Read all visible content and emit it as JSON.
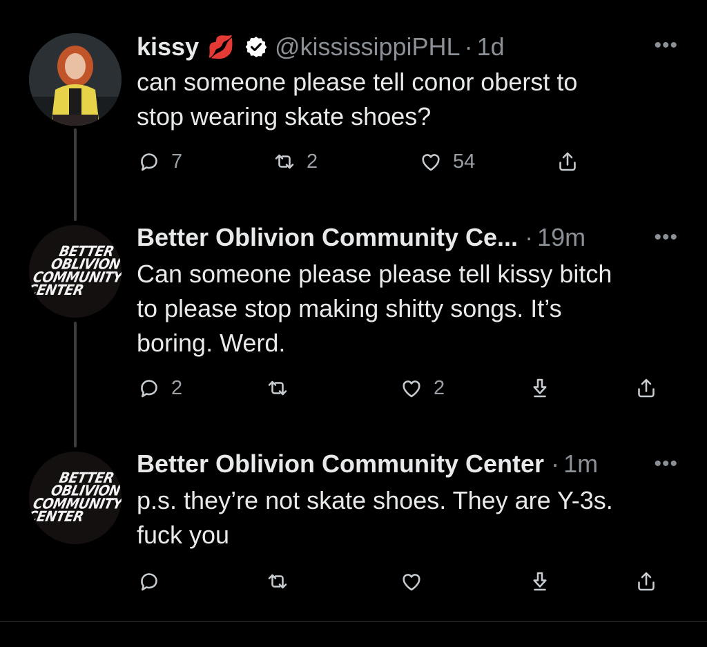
{
  "tweets": [
    {
      "display_name": "kissy",
      "emoji": "💋",
      "handle": "@kississippiPHL",
      "separator": "·",
      "time": "1d",
      "text_line1": "can someone please tell conor oberst to",
      "text_line2": "stop wearing skate shoes?",
      "replies": "7",
      "retweets": "2",
      "likes": "54",
      "more": "•••"
    },
    {
      "display_name": "Better Oblivion Community Ce...",
      "separator": "·",
      "time": "19m",
      "text_line1": "Can someone please please tell kissy bitch",
      "text_line2": "to please stop making shitty songs. It’s",
      "text_line3": "boring. Werd.",
      "replies": "2",
      "likes": "2",
      "more": "•••"
    },
    {
      "display_name": "Better Oblivion Community Center",
      "separator": "·",
      "time": "1m",
      "text_line1": "p.s. they’re not skate shoes. They are Y-3s.",
      "text_line2": "fuck you",
      "more": "•••"
    }
  ],
  "logo": {
    "line1": "BETTER",
    "line2": "OBLIVION",
    "line3": "COMMUNITY",
    "line4": "CENTER"
  },
  "colors": {
    "background": "#000000",
    "text": "#e7e9ea",
    "secondary": "#8b9096",
    "verified": "#ffffff",
    "emoji_red": "#d9202a"
  },
  "icons": {
    "reply": "reply-icon",
    "retweet": "retweet-icon",
    "like": "heart-icon",
    "share": "share-icon",
    "download": "download-arrow-icon",
    "verified": "verified-badge-icon"
  }
}
